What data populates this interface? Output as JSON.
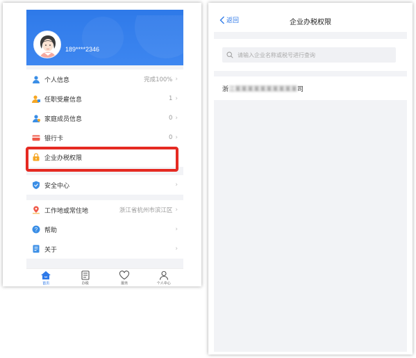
{
  "left": {
    "status_bar": {
      "left": "",
      "center": "",
      "right": ""
    },
    "profile": {
      "name": "",
      "phone": "189****2346"
    },
    "menu_group1": [
      {
        "label": "个人信息",
        "value": "完成100%",
        "icon": "user-icon",
        "icon_color": "#3a8ee6"
      },
      {
        "label": "任职受雇信息",
        "value": "1",
        "icon": "employee-icon",
        "icon_color": "#f5a623"
      },
      {
        "label": "家庭成员信息",
        "value": "0",
        "icon": "family-icon",
        "icon_color": "#3a8ee6"
      },
      {
        "label": "银行卡",
        "value": "0",
        "icon": "bank-card-icon",
        "icon_color": "#ef5a4a"
      },
      {
        "label": "企业办税权限",
        "value": "",
        "icon": "lock-icon",
        "icon_color": "#f5a623"
      }
    ],
    "menu_group2": [
      {
        "label": "安全中心",
        "value": "",
        "icon": "shield-icon",
        "icon_color": "#3a8ee6"
      }
    ],
    "menu_group3": [
      {
        "label": "工作地或常住地",
        "value": "浙江省杭州市滨江区",
        "icon": "location-icon",
        "icon_color": "#ef5a4a"
      },
      {
        "label": "帮助",
        "value": "",
        "icon": "help-icon",
        "icon_color": "#3a8ee6"
      },
      {
        "label": "关于",
        "value": "",
        "icon": "document-icon",
        "icon_color": "#3a8ee6"
      }
    ],
    "tabs": [
      {
        "label": "首页",
        "icon": "home-icon",
        "active": true
      },
      {
        "label": "办税",
        "icon": "tax-icon",
        "active": false
      },
      {
        "label": "服务",
        "icon": "service-icon",
        "active": false
      },
      {
        "label": "个人中心",
        "icon": "person-icon",
        "active": false
      }
    ]
  },
  "right": {
    "back_label": "返回",
    "title": "企业办税权限",
    "search_placeholder": "请输入企业名称或税号进行查询",
    "result": {
      "prefix": "浙",
      "masked": "江某某某某某某某某某某",
      "suffix": "司"
    }
  },
  "colors": {
    "brand": "#2f7ae9",
    "highlight": "#e52a22"
  }
}
